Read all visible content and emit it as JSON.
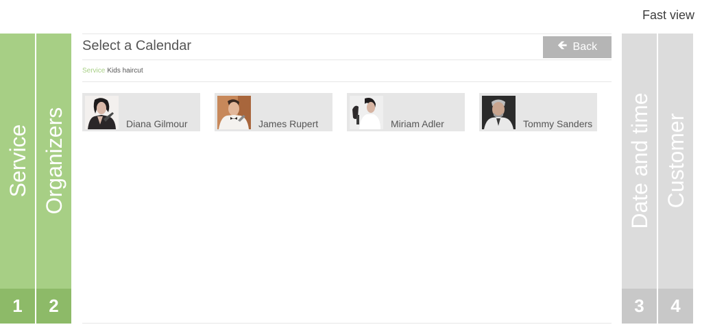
{
  "header": {
    "fast_view": "Fast view"
  },
  "steps": [
    {
      "number": "1",
      "label": "Service",
      "state": "done"
    },
    {
      "number": "2",
      "label": "Organizers",
      "state": "done"
    },
    {
      "number": "3",
      "label": "Date and time",
      "state": "todo"
    },
    {
      "number": "4",
      "label": "Customer",
      "state": "todo"
    }
  ],
  "main": {
    "title": "Select a Calendar",
    "back_label": "Back",
    "breadcrumb": {
      "label": "Service",
      "value": "Kids haircut"
    }
  },
  "organizers": [
    {
      "name": "Diana Gilmour"
    },
    {
      "name": "James Rupert"
    },
    {
      "name": "Miriam Adler"
    },
    {
      "name": "Tommy Sanders"
    }
  ],
  "colors": {
    "done": "#a7cf85",
    "done_number": "#8dba68",
    "todo": "#dcdcdc",
    "todo_number": "#c8c8c8",
    "back_button": "#b5b5b5"
  }
}
